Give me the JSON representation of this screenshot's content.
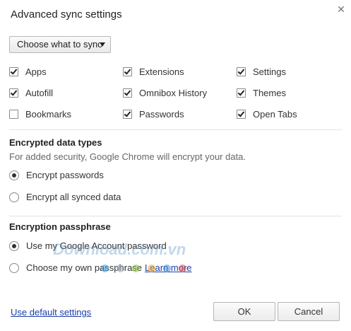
{
  "dialog": {
    "title": "Advanced sync settings",
    "close_icon": "close-icon"
  },
  "sync": {
    "dropdown_label": "Choose what to sync",
    "items": [
      {
        "label": "Apps",
        "checked": true
      },
      {
        "label": "Extensions",
        "checked": true
      },
      {
        "label": "Settings",
        "checked": true
      },
      {
        "label": "Autofill",
        "checked": true
      },
      {
        "label": "Omnibox History",
        "checked": true
      },
      {
        "label": "Themes",
        "checked": true
      },
      {
        "label": "Bookmarks",
        "checked": false
      },
      {
        "label": "Passwords",
        "checked": true
      },
      {
        "label": "Open Tabs",
        "checked": true
      }
    ]
  },
  "encrypted": {
    "title": "Encrypted data types",
    "description": "For added security, Google Chrome will encrypt your data.",
    "options": [
      {
        "label": "Encrypt passwords",
        "selected": true
      },
      {
        "label": "Encrypt all synced data",
        "selected": false
      }
    ]
  },
  "passphrase": {
    "title": "Encryption passphrase",
    "options": [
      {
        "label": "Use my Google Account password",
        "selected": true
      },
      {
        "label": "Choose my own passphrase",
        "selected": false
      }
    ],
    "learn_more": "Learn more"
  },
  "footer": {
    "use_default": "Use default settings",
    "ok": "OK",
    "cancel": "Cancel"
  },
  "watermark": {
    "text": "Download.com.vn",
    "dot_colors": [
      "#3aa0e0",
      "#9aa7b2",
      "#8cc63f",
      "#f5a623",
      "#4a90e2",
      "#e84c4c"
    ]
  }
}
